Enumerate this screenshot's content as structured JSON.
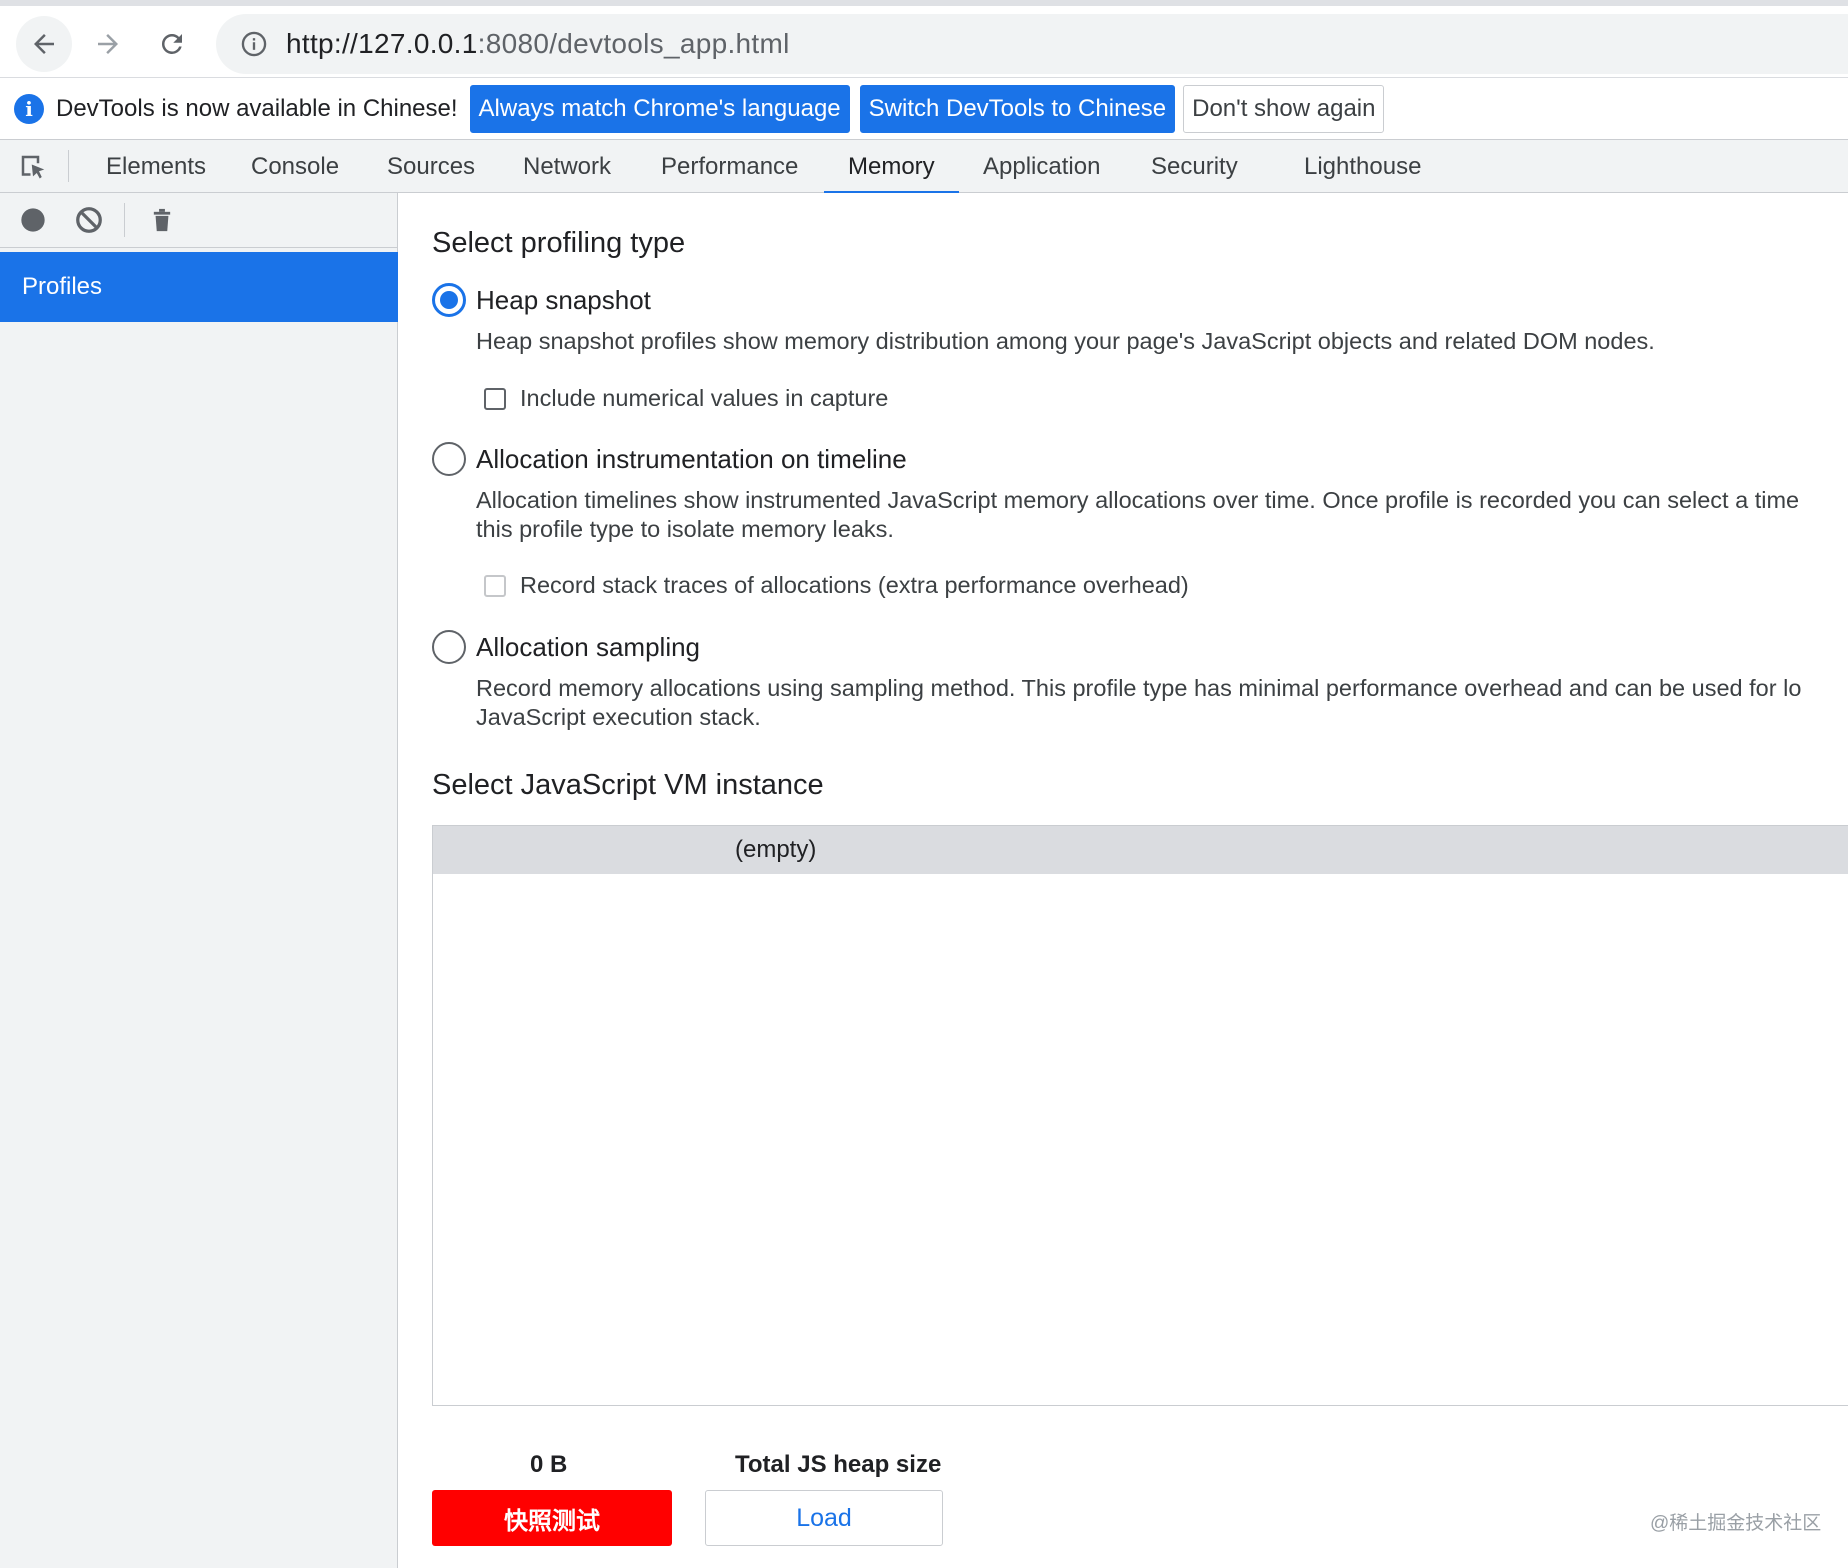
{
  "browser": {
    "url_host": "http://127.0.0.1",
    "url_rest": ":8080/devtools_app.html"
  },
  "infobar": {
    "message": "DevTools is now available in Chinese!",
    "btn_match": "Always match Chrome's language",
    "btn_switch": "Switch DevTools to Chinese",
    "btn_dismiss": "Don't show again"
  },
  "tabs": [
    "Elements",
    "Console",
    "Sources",
    "Network",
    "Performance",
    "Memory",
    "Application",
    "Security",
    "Lighthouse"
  ],
  "active_tab": "Memory",
  "sidebar": {
    "profiles_label": "Profiles"
  },
  "profiling": {
    "heading": "Select profiling type",
    "heap": {
      "label": "Heap snapshot",
      "desc": "Heap snapshot profiles show memory distribution among your page's JavaScript objects and related DOM nodes.",
      "option": "Include numerical values in capture",
      "selected": true
    },
    "timeline": {
      "label": "Allocation instrumentation on timeline",
      "desc1": "Allocation timelines show instrumented JavaScript memory allocations over time. Once profile is recorded you can select a time",
      "desc2": "this profile type to isolate memory leaks.",
      "option": "Record stack traces of allocations (extra performance overhead)"
    },
    "sampling": {
      "label": "Allocation sampling",
      "desc1": "Record memory allocations using sampling method. This profile type has minimal performance overhead and can be used for lo",
      "desc2": "JavaScript execution stack."
    }
  },
  "vm": {
    "heading": "Select JavaScript VM instance",
    "empty": "(empty)",
    "heap_value": "0 B",
    "heap_label": "Total JS heap size"
  },
  "actions": {
    "snapshot": "快照测试",
    "load": "Load"
  },
  "watermark": "@稀土掘金技术社区",
  "colors": {
    "accent": "#1a73e8",
    "snapshot_button": "#ff0000"
  }
}
